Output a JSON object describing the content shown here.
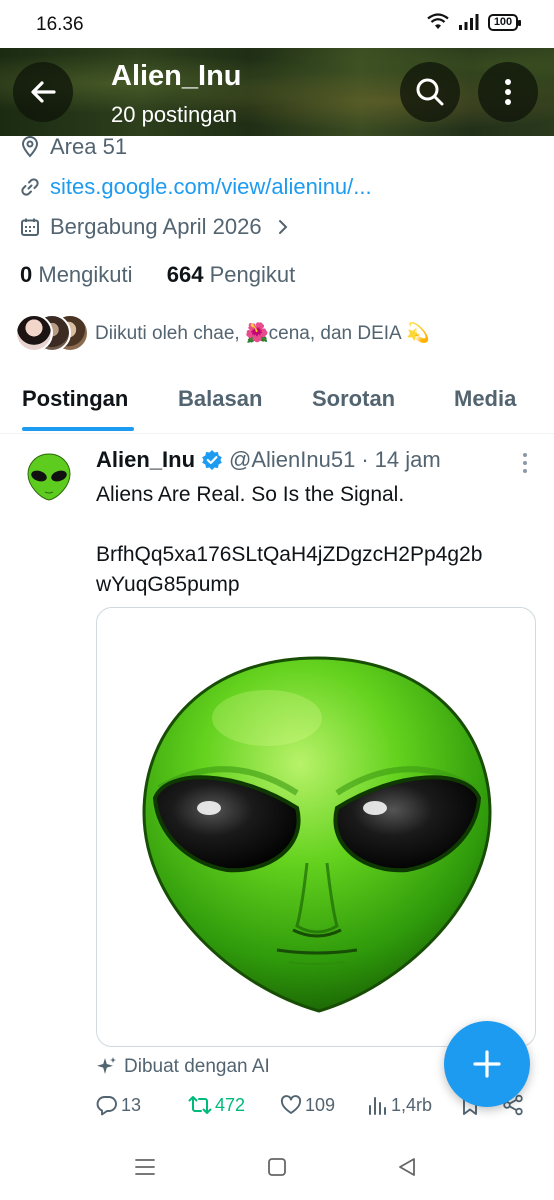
{
  "status_bar": {
    "time": "16.36",
    "battery": "100"
  },
  "header": {
    "title": "Alien_Inu",
    "subtitle": "20 postingan"
  },
  "profile": {
    "location": "Area 51",
    "website": "sites.google.com/view/alieninu/...",
    "joined": "Bergabung April 2026",
    "following_count": "0",
    "following_label": "Mengikuti",
    "followers_count": "664",
    "followers_label": "Pengikut",
    "followed_by": "Diikuti oleh chae, 🌺cena, dan DEIA 💫"
  },
  "tabs": [
    {
      "label": "Postingan",
      "active": true
    },
    {
      "label": "Balasan"
    },
    {
      "label": "Sorotan"
    },
    {
      "label": "Media"
    }
  ],
  "post": {
    "author": "Alien_Inu",
    "handle": "@AlienInu51",
    "separator": "·",
    "time": "14 jam",
    "line1": "Aliens Are Real. So Is the Signal.",
    "line2": "BrfhQq5xa176SLtQaH4jZDgzcH2Pp4g2b",
    "line3": "wYuqG85pump",
    "ai_label": "Dibuat dengan AI",
    "replies": "13",
    "reposts": "472",
    "likes": "109",
    "views": "1,4rb"
  },
  "colors": {
    "accent": "#1d9bf0",
    "repost": "#00ba7c",
    "muted": "#536471",
    "alien_green": "#5ecb1f"
  },
  "icons": [
    "back-arrow-icon",
    "search-icon",
    "more-vertical-icon",
    "location-pin-icon",
    "link-icon",
    "calendar-icon",
    "chevron-right-icon",
    "verified-badge-icon",
    "sparkle-icon",
    "reply-icon",
    "repost-icon",
    "like-icon",
    "views-icon",
    "bookmark-icon",
    "share-icon",
    "plus-icon"
  ]
}
